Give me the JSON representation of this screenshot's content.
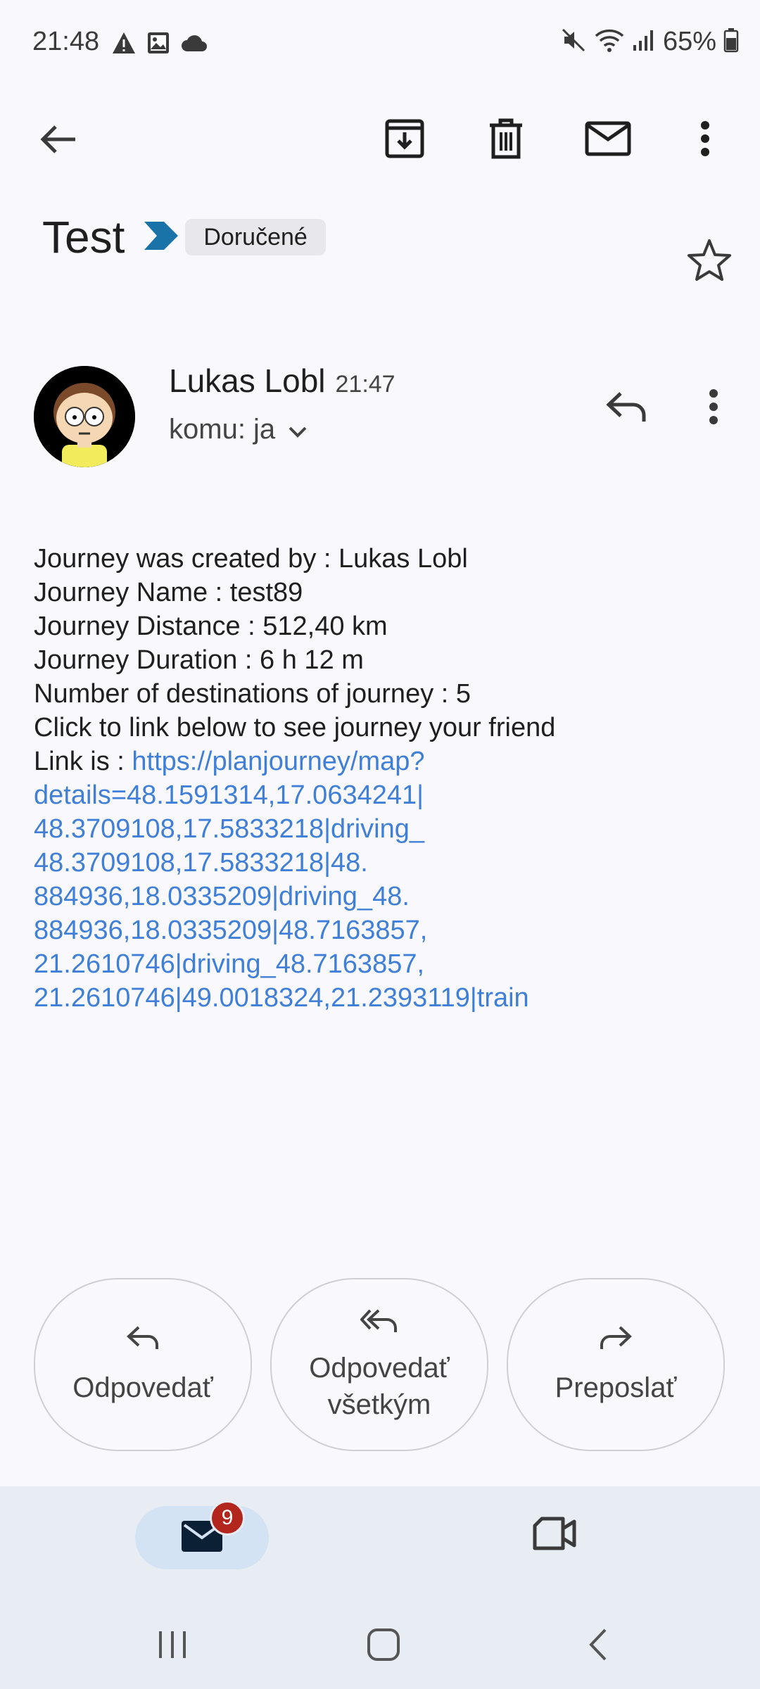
{
  "status_bar": {
    "time": "21:48",
    "battery": "65%",
    "left_icons": [
      "warning-icon",
      "image-icon",
      "cloud-icon"
    ],
    "right_icons": [
      "mute-icon",
      "wifi-icon",
      "signal-icon",
      "battery-icon"
    ]
  },
  "toolbar": {
    "icons": [
      "back-arrow-icon",
      "archive-icon",
      "delete-icon",
      "mark-unread-icon",
      "more-vert-icon"
    ]
  },
  "email": {
    "subject": "Test",
    "label": "Doručené",
    "sender_name": "Lukas Lobl",
    "time": "21:47",
    "recipient": "komu: ja",
    "body_lines": [
      "Journey was created by : Lukas Lobl",
      "Journey Name : test89",
      "Journey Distance : 512,40 km",
      "Journey Duration : 6 h 12 m",
      "Number of destinations of journey : 5",
      "Click to link below to see journey your friend"
    ],
    "link_prefix": "Link is : ",
    "link_lines": [
      "https://planjourney/map?",
      "details=48.1591314,17.0634241|",
      "48.3709108,17.5833218|driving_",
      "48.3709108,17.5833218|48.",
      "884936,18.0335209|driving_48.",
      "884936,18.0335209|48.7163857,",
      "21.2610746|driving_48.7163857,",
      "21.2610746|49.0018324,21.2393119|train"
    ]
  },
  "actions": {
    "reply": "Odpovedať",
    "reply_all_line1": "Odpovedať",
    "reply_all_line2": "všetkým",
    "forward": "Preposlať"
  },
  "bottom_nav": {
    "mail_badge": "9"
  },
  "colors": {
    "link": "#3f7fd8",
    "badge": "#b3261e",
    "nav_bg": "#e8edf3",
    "label_marker": "#1a73a8"
  }
}
